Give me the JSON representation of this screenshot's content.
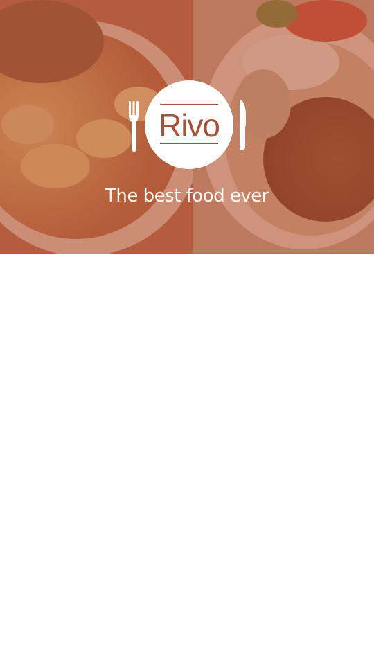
{
  "app": {
    "logo_text": "Rivo",
    "tagline": "The best food ever"
  },
  "colors": {
    "brand": "#a4543a",
    "hero_tint": "#b25234",
    "background": "#ffffff"
  },
  "icons": {
    "fork": "fork-icon",
    "knife": "knife-icon"
  }
}
